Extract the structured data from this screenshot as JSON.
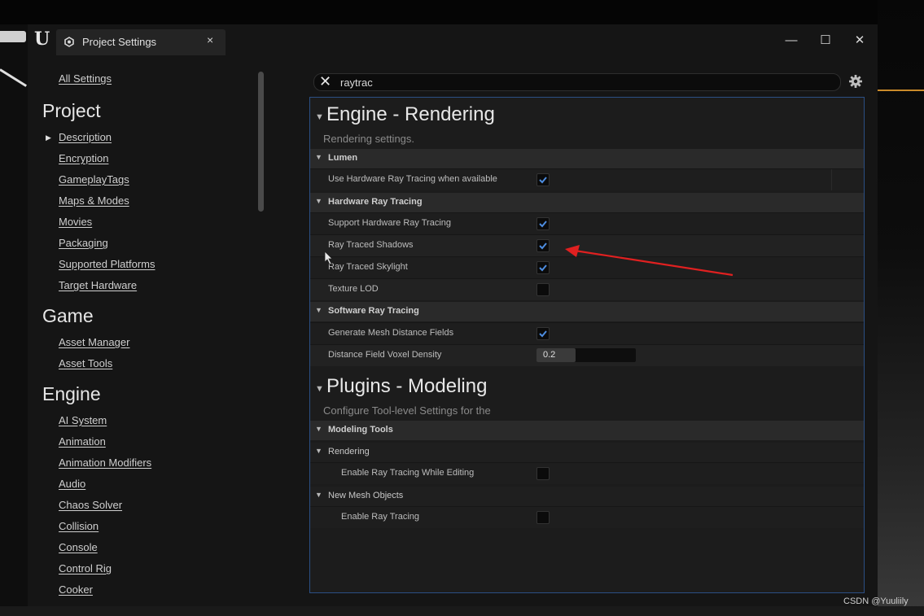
{
  "window": {
    "tab_title": "Project Settings",
    "tab_close": "×",
    "logo": "U",
    "controls": {
      "minimize": "—",
      "maximize": "☐",
      "close": "✕"
    }
  },
  "sidebar": {
    "all_settings": "All Settings",
    "sections": [
      {
        "heading": "Project",
        "items": [
          "Description",
          "Encryption",
          "GameplayTags",
          "Maps & Modes",
          "Movies",
          "Packaging",
          "Supported Platforms",
          "Target Hardware"
        ]
      },
      {
        "heading": "Game",
        "items": [
          "Asset Manager",
          "Asset Tools"
        ]
      },
      {
        "heading": "Engine",
        "items": [
          "AI System",
          "Animation",
          "Animation Modifiers",
          "Audio",
          "Chaos Solver",
          "Collision",
          "Console",
          "Control Rig",
          "Cooker"
        ]
      }
    ],
    "active_marker": "▶"
  },
  "search": {
    "value": "raytrac",
    "clear_icon": "✕",
    "settings_icon": "gear-icon"
  },
  "engine_rendering": {
    "title": "Engine - Rendering",
    "description": "Rendering settings.",
    "lumen": {
      "label": "Lumen",
      "use_hw_rt": {
        "label": "Use Hardware Ray Tracing when available",
        "checked": true
      }
    },
    "hardware_rt": {
      "label": "Hardware Ray Tracing",
      "support_hw_rt": {
        "label": "Support Hardware Ray Tracing",
        "checked": true
      },
      "rt_shadows": {
        "label": "Ray Traced Shadows",
        "checked": true
      },
      "rt_skylight": {
        "label": "Ray Traced Skylight",
        "checked": true
      },
      "texture_lod": {
        "label": "Texture LOD",
        "checked": false
      }
    },
    "software_rt": {
      "label": "Software Ray Tracing",
      "gen_mesh_df": {
        "label": "Generate Mesh Distance Fields",
        "checked": true
      },
      "df_voxel_density": {
        "label": "Distance Field Voxel Density",
        "value": "0.2"
      }
    }
  },
  "plugins_modeling": {
    "title": "Plugins - Modeling",
    "description": "Configure Tool-level Settings for the",
    "modeling_tools": "Modeling Tools",
    "rendering": {
      "label": "Rendering",
      "enable_rt_editing": {
        "label": "Enable Ray Tracing While Editing",
        "checked": false
      }
    },
    "new_mesh_objects": {
      "label": "New Mesh Objects",
      "enable_rt": {
        "label": "Enable Ray Tracing",
        "checked": false
      }
    }
  },
  "colors": {
    "accent_blue": "#2b4f84",
    "check_blue": "#4d8de0",
    "annotation_red": "#e02020",
    "orange_line": "#c98a2a"
  },
  "watermark": "CSDN @Yuuliily"
}
